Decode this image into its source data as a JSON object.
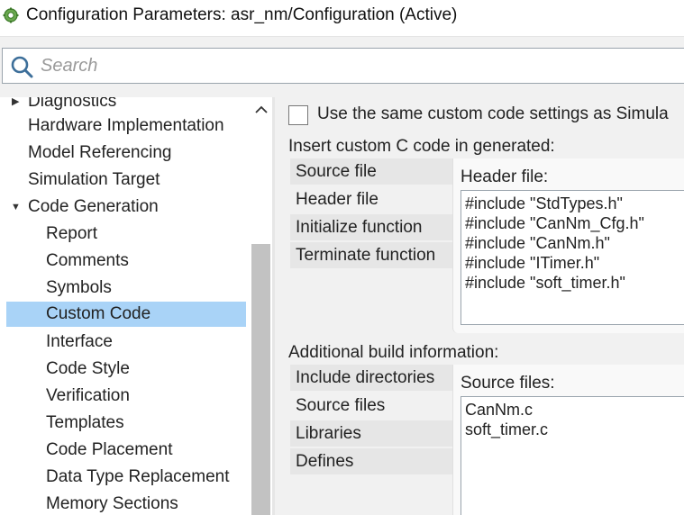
{
  "window": {
    "title": "Configuration Parameters: asr_nm/Configuration (Active)",
    "icon": "gear-cog-icon"
  },
  "search": {
    "placeholder": "Search",
    "value": ""
  },
  "tree": {
    "items": [
      {
        "label": "Diagnostics",
        "level": 1,
        "expander": "collapsed"
      },
      {
        "label": "Hardware Implementation",
        "level": 1
      },
      {
        "label": "Model Referencing",
        "level": 1
      },
      {
        "label": "Simulation Target",
        "level": 1
      },
      {
        "label": "Code Generation",
        "level": 1,
        "expander": "expanded"
      },
      {
        "label": "Report",
        "level": 2
      },
      {
        "label": "Comments",
        "level": 2
      },
      {
        "label": "Symbols",
        "level": 2
      },
      {
        "label": "Custom Code",
        "level": 2,
        "selected": true
      },
      {
        "label": "Interface",
        "level": 2
      },
      {
        "label": "Code Style",
        "level": 2
      },
      {
        "label": "Verification",
        "level": 2
      },
      {
        "label": "Templates",
        "level": 2
      },
      {
        "label": "Code Placement",
        "level": 2
      },
      {
        "label": "Data Type Replacement",
        "level": 2
      },
      {
        "label": "Memory Sections",
        "level": 2
      }
    ],
    "selection_color": "#a9d3f7"
  },
  "custom_code": {
    "use_same_checkbox": {
      "label": "Use the same custom code settings as Simula",
      "checked": false
    },
    "insert_label": "Insert custom C code in generated:",
    "insert_tabs": [
      "Source file",
      "Header file",
      "Initialize function",
      "Terminate function"
    ],
    "insert_active_tab": "Header file",
    "header_file_title": "Header file:",
    "header_file_content": "#include \"StdTypes.h\"\n#include \"CanNm_Cfg.h\"\n#include \"CanNm.h\"\n#include \"ITimer.h\"\n#include \"soft_timer.h\"",
    "build_label": "Additional build information:",
    "build_tabs": [
      "Include directories",
      "Source files",
      "Libraries",
      "Defines"
    ],
    "build_active_tab": "Source files",
    "source_files_title": "Source files:",
    "source_files_content": "CanNm.c\nsoft_timer.c"
  }
}
